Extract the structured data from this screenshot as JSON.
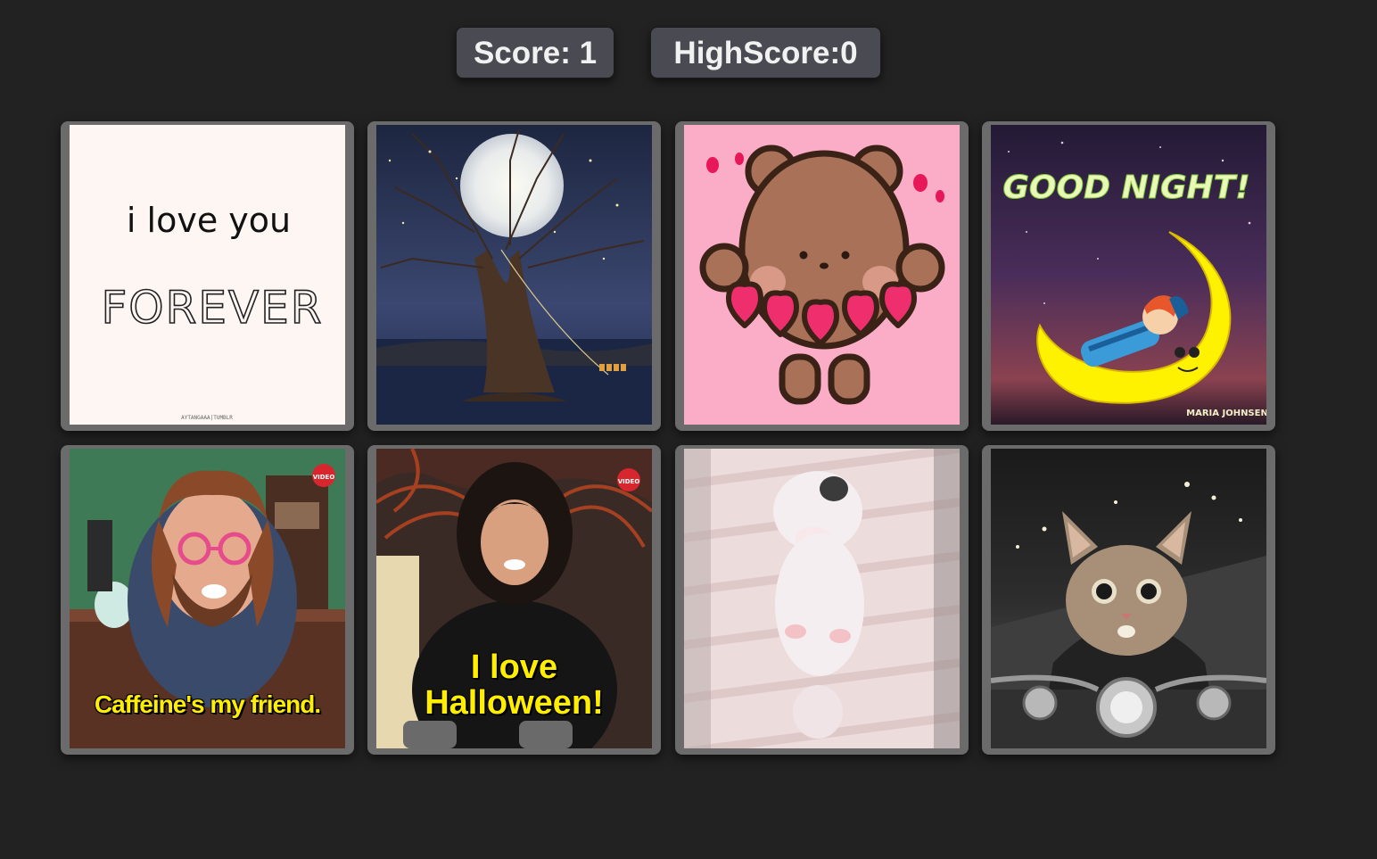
{
  "scores": {
    "score_label": "Score: 1",
    "highscore_label": "HighScore:0"
  },
  "cards": [
    {
      "name": "card-love-forever",
      "line1": "i love you",
      "line2": "FOREVER",
      "credit": "AYTANGAAA|TUMBLR"
    },
    {
      "name": "card-moon-tree"
    },
    {
      "name": "card-teddy-hearts"
    },
    {
      "name": "card-good-night",
      "title": "GOOD NIGHT!",
      "credit": "MARIA JOHNSEN"
    },
    {
      "name": "card-caffeine",
      "caption": "Caffeine's my friend.",
      "badge": "VIDEO"
    },
    {
      "name": "card-halloween",
      "caption_line1": "I love",
      "caption_line2": "Halloween!",
      "badge": "VIDEO"
    },
    {
      "name": "card-puppy"
    },
    {
      "name": "card-biker-cat"
    }
  ]
}
